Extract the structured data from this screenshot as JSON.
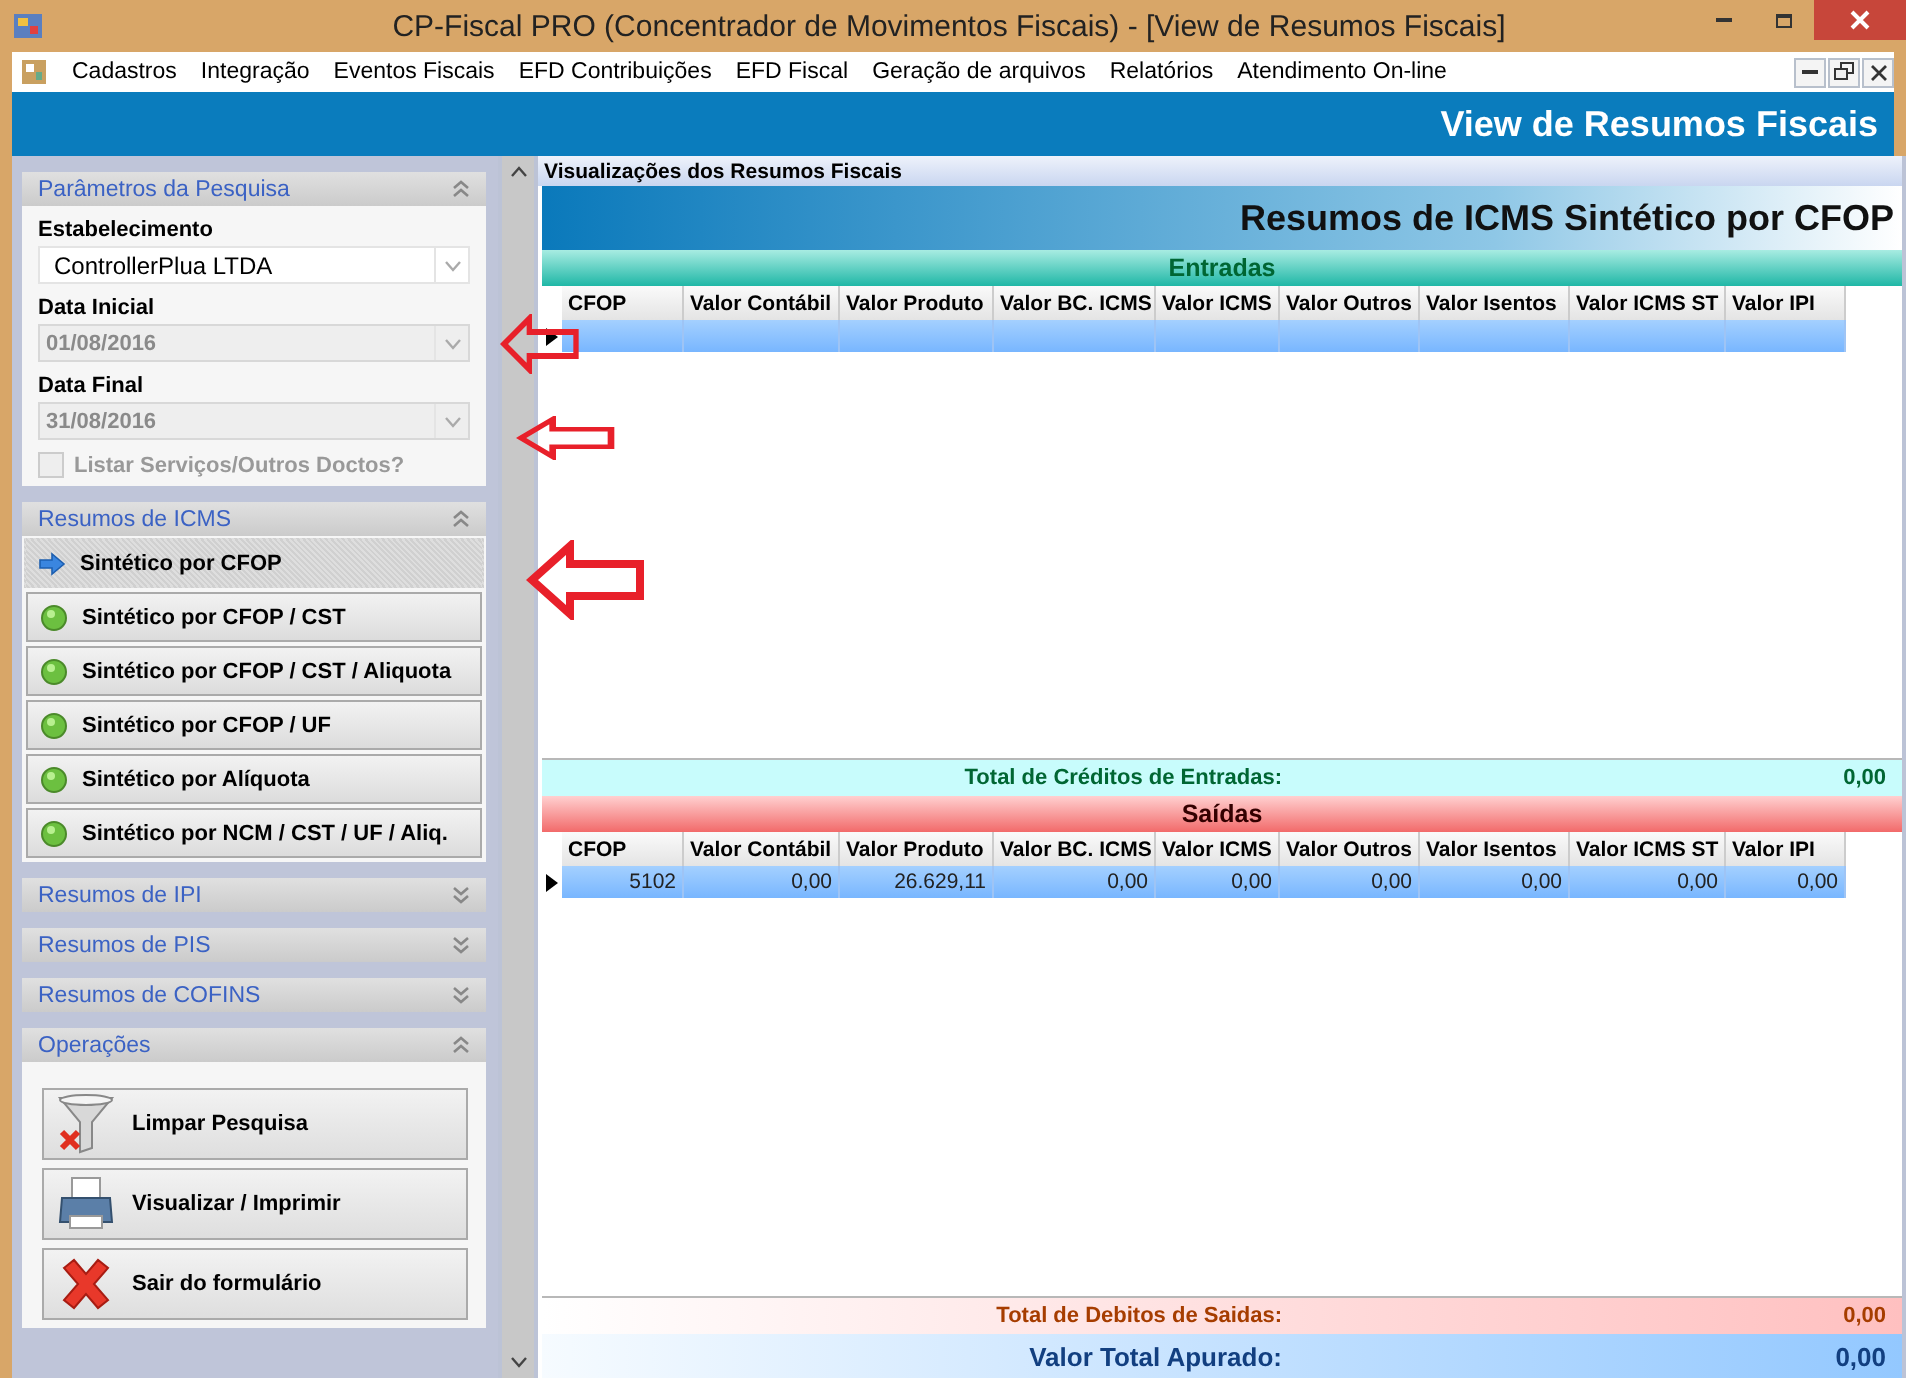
{
  "window": {
    "title": "CP-Fiscal PRO (Concentrador de Movimentos Fiscais) - [View de Resumos Fiscais]"
  },
  "menu": [
    "Cadastros",
    "Integração",
    "Eventos Fiscais",
    "EFD Contribuições",
    "EFD Fiscal",
    "Geração de arquivos",
    "Relatórios",
    "Atendimento On-line"
  ],
  "header": {
    "title": "View de Resumos Fiscais"
  },
  "sidebar": [
    {
      "kind": "params",
      "title": "Parâmetros da Pesquisa",
      "expanded": true,
      "fields": [
        {
          "label": "Estabelecimento",
          "value": "ControllerPlua LTDA",
          "disabled": false
        },
        {
          "label": "Data Inicial",
          "value": "01/08/2016",
          "disabled": true
        },
        {
          "label": "Data Final",
          "value": "31/08/2016",
          "disabled": true
        }
      ],
      "checkbox": {
        "label": "Listar Serviços/Outros Doctos?",
        "checked": false,
        "disabled": true
      }
    },
    {
      "kind": "list",
      "title": "Resumos de ICMS",
      "expanded": true,
      "items": [
        {
          "label": "Sintético por CFOP",
          "selected": true
        },
        {
          "label": "Sintético por CFOP / CST",
          "selected": false
        },
        {
          "label": "Sintético por CFOP / CST / Aliquota",
          "selected": false
        },
        {
          "label": "Sintético por CFOP / UF",
          "selected": false
        },
        {
          "label": "Sintético por Alíquota",
          "selected": false
        },
        {
          "label": "Sintético por NCM /  CST / UF / Aliq.",
          "selected": false
        }
      ]
    },
    {
      "title": "Resumos de IPI",
      "expanded": false
    },
    {
      "title": "Resumos de PIS",
      "expanded": false
    },
    {
      "title": "Resumos de COFINS",
      "expanded": false
    },
    {
      "kind": "actions",
      "title": "Operações",
      "expanded": true,
      "buttons": [
        {
          "kind": "clear",
          "label": "Limpar Pesquisa"
        },
        {
          "kind": "print",
          "label": "Visualizar / Imprimir"
        },
        {
          "kind": "exit",
          "label": "Sair do formulário"
        }
      ]
    }
  ],
  "main": {
    "panel_title": "Visualizações dos Resumos Fiscais",
    "report_title": "Resumos de ICMS Sintético por CFOP",
    "sections": [
      {
        "kind": "in",
        "title": "Entradas",
        "columns": [
          "CFOP",
          "Valor Contábil",
          "Valor Produto",
          "Valor BC. ICMS",
          "Valor ICMS",
          "Valor Outros",
          "Valor Isentos",
          "Valor ICMS ST",
          "Valor IPI"
        ],
        "rows": [
          {
            "selected": true,
            "cells": []
          }
        ],
        "total_label": "Total de Créditos de Entradas:",
        "total_value": "0,00"
      },
      {
        "kind": "out",
        "title": "Saídas",
        "columns": [
          "CFOP",
          "Valor Contábil",
          "Valor Produto",
          "Valor BC. ICMS",
          "Valor ICMS",
          "Valor Outros",
          "Valor Isentos",
          "Valor ICMS ST",
          "Valor IPI"
        ],
        "rows": [
          {
            "selected": true,
            "cells": [
              "5102",
              "0,00",
              "26.629,11",
              "0,00",
              "0,00",
              "0,00",
              "0,00",
              "0,00",
              "0,00"
            ]
          }
        ],
        "total_label": "Total de Debitos de Saidas:",
        "total_value": "0,00"
      }
    ],
    "grand_total_label": "Valor Total Apurado:",
    "grand_total_value": "0,00"
  }
}
